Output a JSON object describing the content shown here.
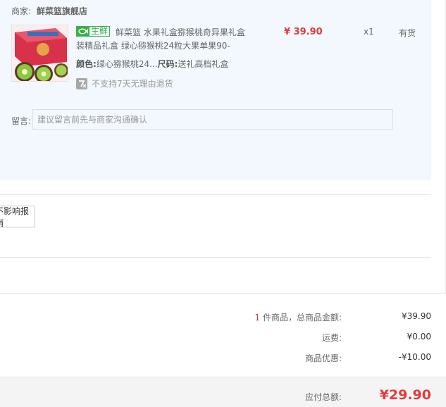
{
  "shop": {
    "label": "商家:",
    "name": "鲜菜篮旗舰店"
  },
  "product": {
    "badge": "生鲜",
    "badge_icon": "fish-icon",
    "title": "鲜菜篮 水果礼盒猕猴桃奇异果礼盒装精品礼盒 绿心猕猴桃24粒大果单果90-",
    "color_label": "颜色:",
    "color_value": "绿心猕猴桃24...",
    "size_label": "尺码:",
    "size_value": "送礼高档礼盒",
    "no_return_icon": "seven-day-return-icon",
    "no_return_text": "不支持7天无理由退货",
    "price": "¥ 39.90",
    "quantity": "x1",
    "stock": "有货"
  },
  "remark": {
    "label": "留言:",
    "placeholder": "建议留言前先与商家沟通确认"
  },
  "invoice": {
    "button_label": "不影响报销"
  },
  "summary": {
    "count": "1",
    "count_suffix": " 件商品，总商品金额:",
    "goods_total": "¥39.90",
    "shipping_label": "运费:",
    "shipping": "¥0.00",
    "discount_label": "商品优惠:",
    "discount": "-¥10.00"
  },
  "total": {
    "label": "应付总额:",
    "value": "¥29.90"
  },
  "colors": {
    "accent_red": "#e4393c",
    "fresh_green": "#39b14a",
    "panel_bg": "#f3f8fe"
  }
}
